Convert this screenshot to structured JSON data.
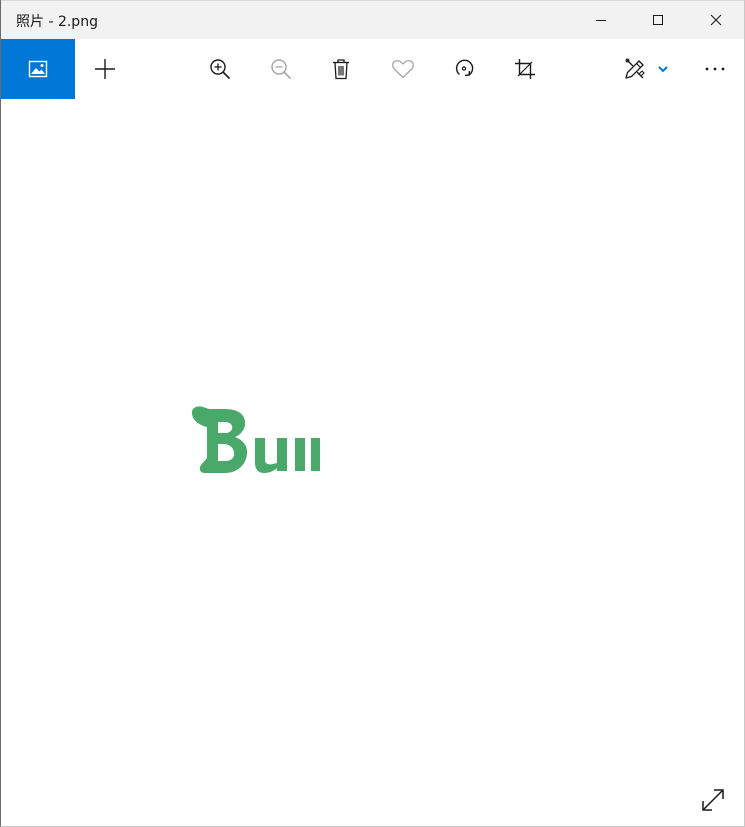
{
  "window": {
    "title": "照片 - 2.png"
  },
  "caption_buttons": {
    "minimize": "minimize-icon",
    "maximize": "maximize-icon",
    "close": "close-icon"
  },
  "toolbar": {
    "items": [
      {
        "name": "see-all-photos",
        "icon": "image-icon",
        "active": true
      },
      {
        "name": "add-to-album",
        "icon": "plus-icon"
      },
      {
        "name": "zoom-in",
        "icon": "zoom-in-icon"
      },
      {
        "name": "zoom-out",
        "icon": "zoom-out-icon",
        "disabled": true
      },
      {
        "name": "delete",
        "icon": "trash-icon"
      },
      {
        "name": "favorite",
        "icon": "heart-icon",
        "disabled": true
      },
      {
        "name": "rotate",
        "icon": "rotate-icon"
      },
      {
        "name": "crop",
        "icon": "crop-icon"
      },
      {
        "name": "edit-and-create",
        "icon": "edit-icon",
        "dropdown": "chevron-down-icon"
      },
      {
        "name": "see-more",
        "icon": "more-icon"
      }
    ]
  },
  "image": {
    "text": "Bu",
    "color": "#4aa86b"
  },
  "colors": {
    "accent": "#0078d7",
    "titlebar": "#f2f2f2",
    "icon": "#1a1a1a",
    "icon_disabled": "#a6a6a6"
  },
  "fullscreen": {
    "icon": "expand-icon"
  }
}
